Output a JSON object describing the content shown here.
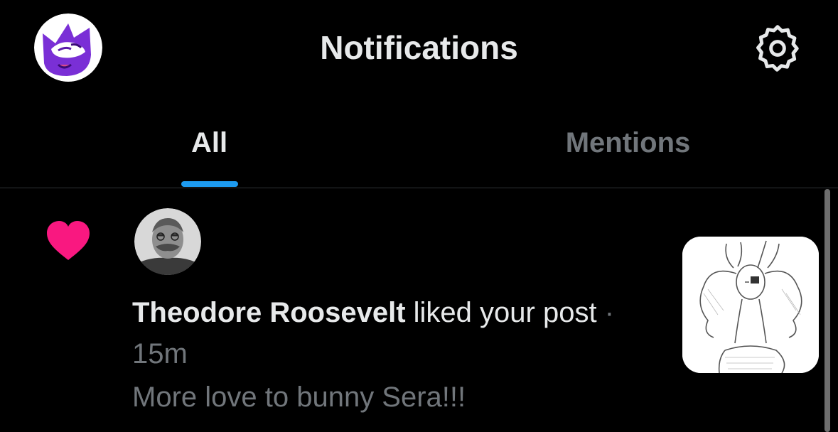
{
  "header": {
    "title": "Notifications",
    "avatar_icon": "purple-cat-avatar",
    "settings_icon": "gear-icon"
  },
  "tabs": [
    {
      "label": "All",
      "active": true
    },
    {
      "label": "Mentions",
      "active": false
    }
  ],
  "colors": {
    "background": "#000000",
    "text_primary": "#e7e9ea",
    "text_secondary": "#71767b",
    "accent": "#1d9bf0",
    "like": "#f91880",
    "divider": "#2f3336"
  },
  "notification": {
    "type_icon": "heart-icon",
    "user_name": "Theodore Roosevelt",
    "action": "liked your post",
    "separator": "·",
    "time": "15m",
    "preview": "More love to bunny Sera!!!",
    "thumbnail_icon": "bunny-girl-sketch-thumbnail"
  }
}
